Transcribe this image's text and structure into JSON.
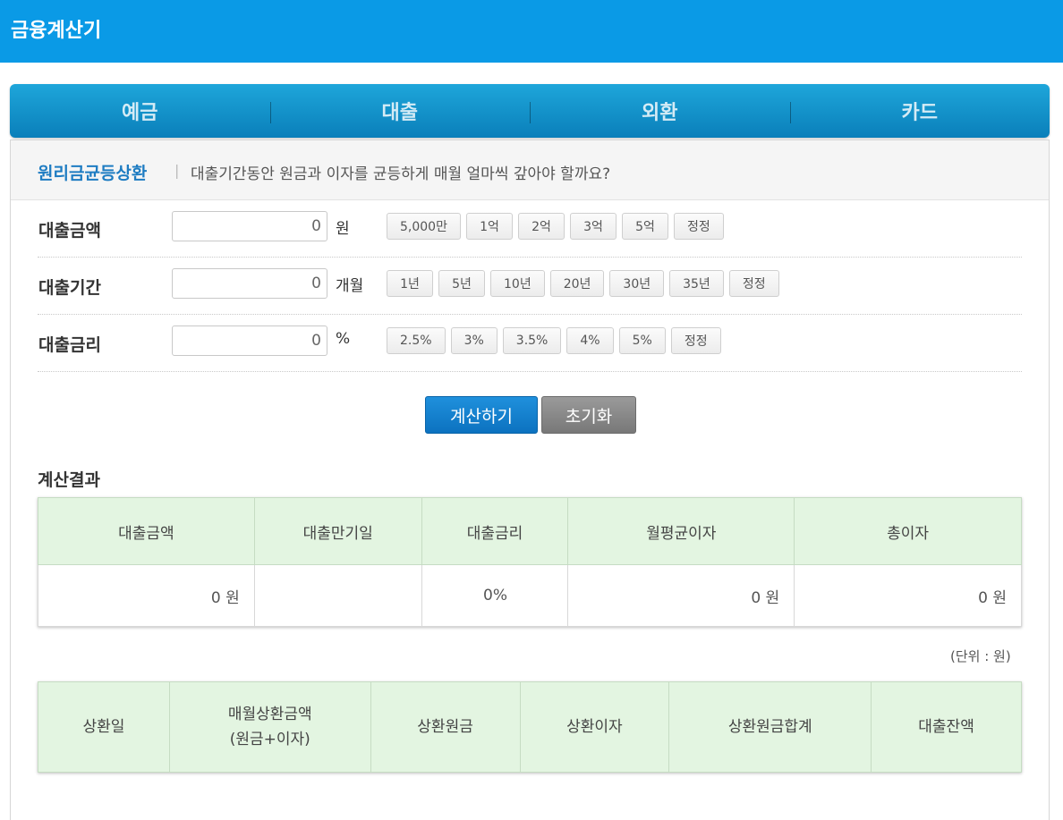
{
  "app": {
    "title": "금융계산기"
  },
  "tabs": [
    {
      "label": "예금"
    },
    {
      "label": "대출"
    },
    {
      "label": "외환"
    },
    {
      "label": "카드"
    }
  ],
  "calculator": {
    "name": "원리금균등상환",
    "separator": "|",
    "description": "대출기간동안 원금과 이자를 균등하게 매월 얼마씩 갚아야 할까요?"
  },
  "fields": {
    "amount": {
      "label": "대출금액",
      "value": "0",
      "unit": "원",
      "presets": [
        "5,000만",
        "1억",
        "2억",
        "3억",
        "5억",
        "정정"
      ]
    },
    "period": {
      "label": "대출기간",
      "value": "0",
      "unit": "개월",
      "presets": [
        "1년",
        "5년",
        "10년",
        "20년",
        "30년",
        "35년",
        "정정"
      ]
    },
    "rate": {
      "label": "대출금리",
      "value": "0",
      "unit": "%",
      "presets": [
        "2.5%",
        "3%",
        "3.5%",
        "4%",
        "5%",
        "정정"
      ]
    }
  },
  "buttons": {
    "calculate": "계산하기",
    "reset": "초기화"
  },
  "result": {
    "title": "계산결과",
    "headers": [
      "대출금액",
      "대출만기일",
      "대출금리",
      "월평균이자",
      "총이자"
    ],
    "values": {
      "amount": "0 원",
      "maturity": "",
      "rate": "0%",
      "monthly_interest": "0 원",
      "total_interest": "0 원"
    }
  },
  "schedule": {
    "unit_note": "(단위 : 원)",
    "headers": {
      "date": "상환일",
      "monthly_line1": "매월상환금액",
      "monthly_line2": "(원금+이자)",
      "principal": "상환원금",
      "interest": "상환이자",
      "principal_total": "상환원금합계",
      "balance": "대출잔액"
    }
  }
}
